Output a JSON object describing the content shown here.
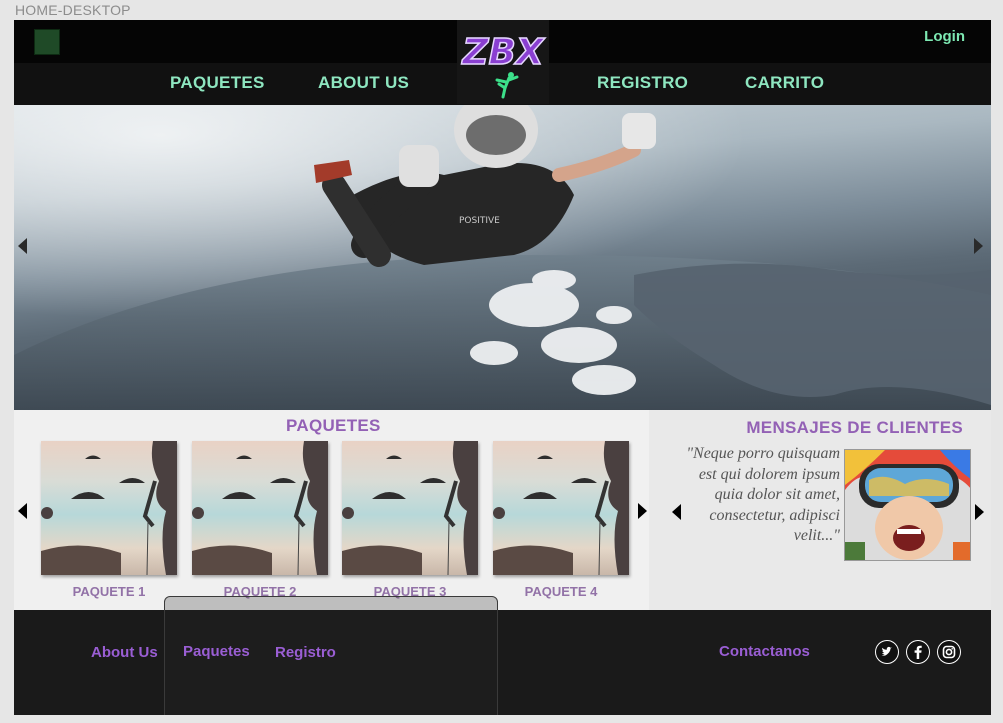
{
  "artboard": {
    "label": "HOME-DESKTOP"
  },
  "header": {
    "login_label": "Login",
    "logo_text": "ZBX",
    "nav": {
      "paquetes": "PAQUETES",
      "about": "ABOUT US",
      "registro": "REGISTRO",
      "carrito": "CARRITO"
    }
  },
  "hero": {
    "prev_icon": "triangle-left",
    "next_icon": "triangle-right"
  },
  "packages": {
    "title": "PAQUETES",
    "items": [
      {
        "label": "PAQUETE 1"
      },
      {
        "label": "PAQUETE 2"
      },
      {
        "label": "PAQUETE 3"
      },
      {
        "label": "PAQUETE 4"
      }
    ]
  },
  "testimonials": {
    "title": "MENSAJES DE CLIENTES",
    "quote": "\"Neque porro quisquam est qui dolorem ipsum quia dolor sit amet, consectetur, adipisci velit...\""
  },
  "footer": {
    "links": {
      "about": "About Us",
      "paquetes": "Paquetes",
      "registro": "Registro",
      "contact": "Contactanos"
    },
    "social": [
      "twitter-icon",
      "facebook-icon",
      "instagram-icon"
    ]
  },
  "colors": {
    "nav_text": "#8ee6c0",
    "section_title": "#9361b5",
    "footer_link": "#9a5ed4",
    "header_bg": "#050505"
  }
}
